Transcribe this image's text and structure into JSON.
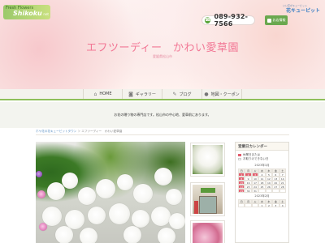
{
  "header": {
    "logo_left_line1": "Fresh Flowers",
    "logo_left_brand": "Shikoku",
    "logo_left_suffix": "net",
    "logo_right_sub": "いい花がキューピット",
    "logo_right_main": "花キューピット",
    "phone": "089-932-7566",
    "order_label": "お店情報",
    "shop_name": "エフツーディー　かわい愛草園",
    "shop_location": "愛媛県松山市"
  },
  "nav": {
    "items": [
      {
        "icon": "home-icon",
        "label": "HOME"
      },
      {
        "icon": "camera-icon",
        "label": "ギャラリー"
      },
      {
        "icon": "pen-icon",
        "label": "ブログ"
      },
      {
        "icon": "map-pin-icon",
        "label": "地図・クーポン"
      }
    ]
  },
  "intro": {
    "text": "お花の贈り物の専門店です。松山市の中心地、愛車前にあります。"
  },
  "breadcrumb": {
    "link": "ホヤ花の花キューピットタウン",
    "separator": "＞",
    "current": "エフツーディー　かわい愛草園"
  },
  "sidebar": {
    "title": "営業日カレンダー",
    "legend": [
      {
        "label": "休業日または",
        "color": "#e25e6e"
      },
      {
        "label": "お取りのできない日",
        "color": "#ffffff"
      }
    ],
    "calendars": [
      {
        "caption": "2023年1月",
        "weekdays": [
          "日",
          "月",
          "火",
          "水",
          "木",
          "金",
          "土"
        ],
        "rows": [
          [
            "1",
            "2",
            "3",
            "4",
            "5",
            "6",
            "7"
          ],
          [
            "8",
            "9",
            "10",
            "11",
            "12",
            "13",
            "14"
          ],
          [
            "15",
            "16",
            "17",
            "18",
            "19",
            "20",
            "21"
          ],
          [
            "22",
            "23",
            "24",
            "25",
            "26",
            "27",
            "28"
          ],
          [
            "29",
            "30",
            "31",
            "",
            "",
            "",
            ""
          ]
        ],
        "holidays": [
          "1",
          "2",
          "3",
          "8",
          "15",
          "22",
          "29"
        ]
      },
      {
        "caption": "2023年2月",
        "weekdays": [
          "日",
          "月",
          "火",
          "水",
          "木",
          "金",
          "土"
        ],
        "rows": [
          [
            "",
            "",
            "",
            "1",
            "2",
            "3",
            "4"
          ]
        ],
        "holidays": []
      }
    ]
  },
  "colors": {
    "accent_pink": "#f27795",
    "nav_underline": "#8fbf5a",
    "holiday_red": "#e25e6e",
    "phone_green": "#5aa53a"
  }
}
